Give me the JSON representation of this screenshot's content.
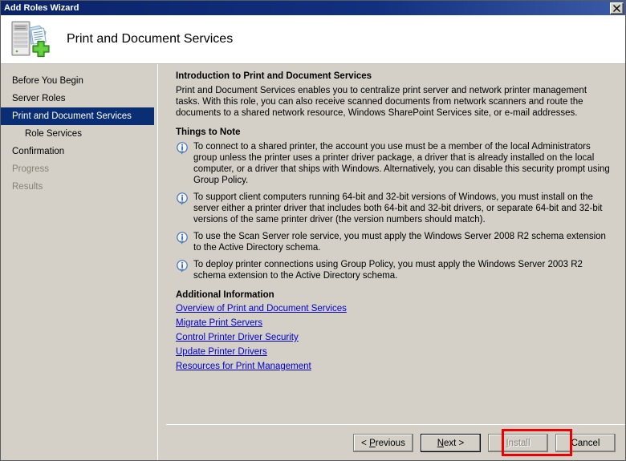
{
  "window": {
    "title": "Add Roles Wizard",
    "close_icon": "close-icon"
  },
  "header": {
    "title": "Print and Document Services",
    "icon": "print-document-services-add-icon"
  },
  "sidebar": {
    "items": [
      {
        "label": "Before You Begin",
        "state": "normal",
        "indent": false
      },
      {
        "label": "Server Roles",
        "state": "normal",
        "indent": false
      },
      {
        "label": "Print and Document Services",
        "state": "selected",
        "indent": false
      },
      {
        "label": "Role Services",
        "state": "normal",
        "indent": true
      },
      {
        "label": "Confirmation",
        "state": "normal",
        "indent": false
      },
      {
        "label": "Progress",
        "state": "disabled",
        "indent": false
      },
      {
        "label": "Results",
        "state": "disabled",
        "indent": false
      }
    ]
  },
  "content": {
    "intro_heading": "Introduction to Print and Document Services",
    "intro_body": "Print and Document Services enables you to centralize print server and network printer management tasks. With this role, you can also receive scanned documents from network scanners and route the documents to a shared network resource, Windows SharePoint Services site, or e-mail addresses.",
    "notes_heading": "Things to Note",
    "notes": [
      {
        "icon": "info-icon",
        "text": "To connect to a shared printer, the account you use must be a member of the local Administrators group unless the printer uses a printer driver package, a driver that is already installed on the local computer, or a driver that ships with Windows. Alternatively, you can disable this security prompt using Group Policy."
      },
      {
        "icon": "info-icon",
        "text": "To support client computers running 64-bit and 32-bit versions of Windows, you must install on the server either a printer driver that includes both 64-bit and 32-bit drivers, or separate 64-bit and 32-bit versions of the same printer driver (the version numbers should match)."
      },
      {
        "icon": "info-icon",
        "text": "To use the Scan Server role service, you must apply the Windows Server 2008 R2 schema extension to the Active Directory schema."
      },
      {
        "icon": "info-icon",
        "text": "To deploy printer connections using Group Policy, you must apply the Windows Server 2003 R2 schema extension to the Active Directory schema."
      }
    ],
    "additional_heading": "Additional Information",
    "links": [
      "Overview of Print and Document Services",
      "Migrate Print Servers",
      "Control Printer Driver Security",
      "Update Printer Drivers",
      "Resources for Print Management"
    ]
  },
  "footer": {
    "previous_label": "< Previous",
    "previous_accel": "P",
    "next_label": "Next >",
    "next_accel": "N",
    "install_label": "Install",
    "install_accel": "I",
    "install_enabled": false,
    "cancel_label": "Cancel"
  },
  "annotation": {
    "highlight_target": "next-button",
    "highlight_color": "#ee0000"
  }
}
